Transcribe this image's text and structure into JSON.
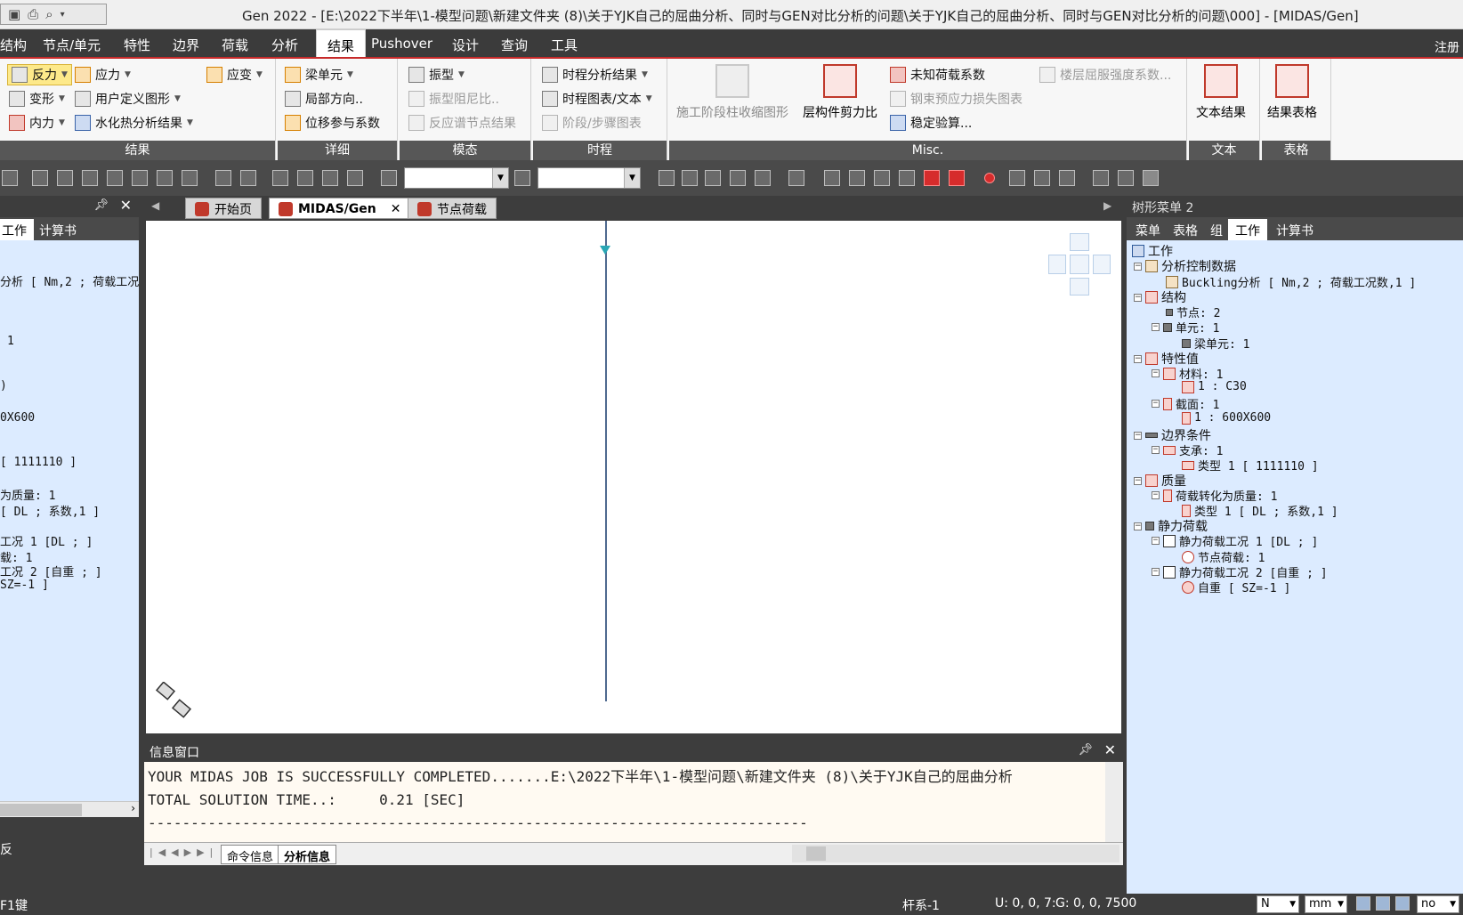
{
  "title": "Gen 2022 - [E:\\2022下半年\\1-模型问题\\新建文件夹 (8)\\关于YJK自己的屈曲分析、同时与GEN对比分析的问题\\关于YJK自己的屈曲分析、同时与GEN对比分析的问题\\000] - [MIDAS/Gen]",
  "menu": {
    "items": [
      "结构",
      "节点/单元",
      "特性",
      "边界",
      "荷载",
      "分析",
      "结果",
      "Pushover",
      "设计",
      "查询",
      "工具"
    ],
    "active": "结果",
    "right": "注册"
  },
  "ribbon": {
    "results": {
      "label": "结果",
      "reaction": "反力",
      "stress": "应力",
      "strain": "应变",
      "deform": "变形",
      "user_diagram": "用户定义图形",
      "force": "内力",
      "hydration": "水化热分析结果"
    },
    "detail": {
      "label": "详细",
      "beam": "梁单元",
      "local_dir": "局部方向..",
      "disp_factor": "位移参与系数"
    },
    "mode": {
      "label": "模态",
      "mode_shape": "振型",
      "damping": "振型阻尼比..",
      "spectrum_node": "反应谱节点结果"
    },
    "history": {
      "label": "时程",
      "th_result": "时程分析结果",
      "th_graph": "时程图表/文本",
      "stage_graph": "阶段/步骤图表"
    },
    "misc": {
      "label": "Misc.",
      "construction": "施工阶段柱收缩图形",
      "shear_ratio": "层构件剪力比",
      "unknown_load": "未知荷载系数",
      "tendon_loss": "钢束预应力损失图表",
      "stability": "稳定验算...",
      "yield_strength": "楼层屈服强度系数..."
    },
    "text": {
      "label": "文本",
      "text_result": "文本结果"
    },
    "table": {
      "label": "表格",
      "result_table": "结果表格"
    }
  },
  "left_panel": {
    "tabs": [
      "工作",
      "计算书"
    ],
    "lines": [
      "分析 [ Nm,2 ; 荷载工况",
      "1",
      ")",
      "0X600",
      "[ 1111110 ]",
      "为质量: 1",
      "[ DL ; 系数,1 ]",
      "工况 1 [DL ; ]",
      "载: 1",
      "工况 2 [自重 ; ]",
      "SZ=-1 ]"
    ],
    "footer": "反"
  },
  "doc_tabs": [
    "开始页",
    "MIDAS/Gen",
    "节点荷载"
  ],
  "message_window": {
    "title": "信息窗口",
    "lines": [
      "YOUR MIDAS JOB IS SUCCESSFULLY COMPLETED.......E:\\2022下半年\\1-模型问题\\新建文件夹 (8)\\关于YJK自己的屈曲分析",
      "TOTAL SOLUTION TIME..:     0.21 [SEC]",
      "-----------------------------------------------------------------------------"
    ],
    "tabs": [
      "命令信息",
      "分析信息"
    ],
    "active_tab": "分析信息"
  },
  "tree": {
    "title": "树形菜单 2",
    "tabs": [
      "菜单",
      "表格",
      "组",
      "工作",
      "计算书"
    ],
    "active_tab": "工作",
    "rows": [
      {
        "text": "工作",
        "level": 0
      },
      {
        "text": "分析控制数据",
        "level": 1
      },
      {
        "text": "Buckling分析 [ Nm,2 ; 荷载工况数,1 ]",
        "level": 2
      },
      {
        "text": "结构",
        "level": 1
      },
      {
        "text": "节点: 2",
        "level": 2
      },
      {
        "text": "单元: 1",
        "level": 2
      },
      {
        "text": "梁单元: 1",
        "level": 3
      },
      {
        "text": "特性值",
        "level": 1
      },
      {
        "text": "材料: 1",
        "level": 2
      },
      {
        "text": "1 : C30",
        "level": 3
      },
      {
        "text": "截面: 1",
        "level": 2
      },
      {
        "text": "1 : 600X600",
        "level": 3
      },
      {
        "text": "边界条件",
        "level": 1
      },
      {
        "text": "支承: 1",
        "level": 2
      },
      {
        "text": "类型 1 [ 1111110 ]",
        "level": 3
      },
      {
        "text": "质量",
        "level": 1
      },
      {
        "text": "荷载转化为质量: 1",
        "level": 2
      },
      {
        "text": "类型 1 [ DL ; 系数,1 ]",
        "level": 3
      },
      {
        "text": "静力荷载",
        "level": 1
      },
      {
        "text": "静力荷载工况 1 [DL ; ]",
        "level": 2
      },
      {
        "text": "节点荷载: 1",
        "level": 3
      },
      {
        "text": "静力荷载工况 2 [自重 ; ]",
        "level": 2
      },
      {
        "text": "自重 [ SZ=-1 ]",
        "level": 3
      }
    ]
  },
  "status": {
    "help": "F1键",
    "model_type": "杆系-1",
    "ucs": "U: 0, 0, 7:",
    "gcs": "G: 0, 0, 7500",
    "force_unit": "N",
    "length_unit": "mm",
    "last": "no"
  },
  "colors": {
    "accent": "#c72a2a",
    "panel_bg": "#dcebff",
    "dark_bg": "#3d3d3d"
  }
}
